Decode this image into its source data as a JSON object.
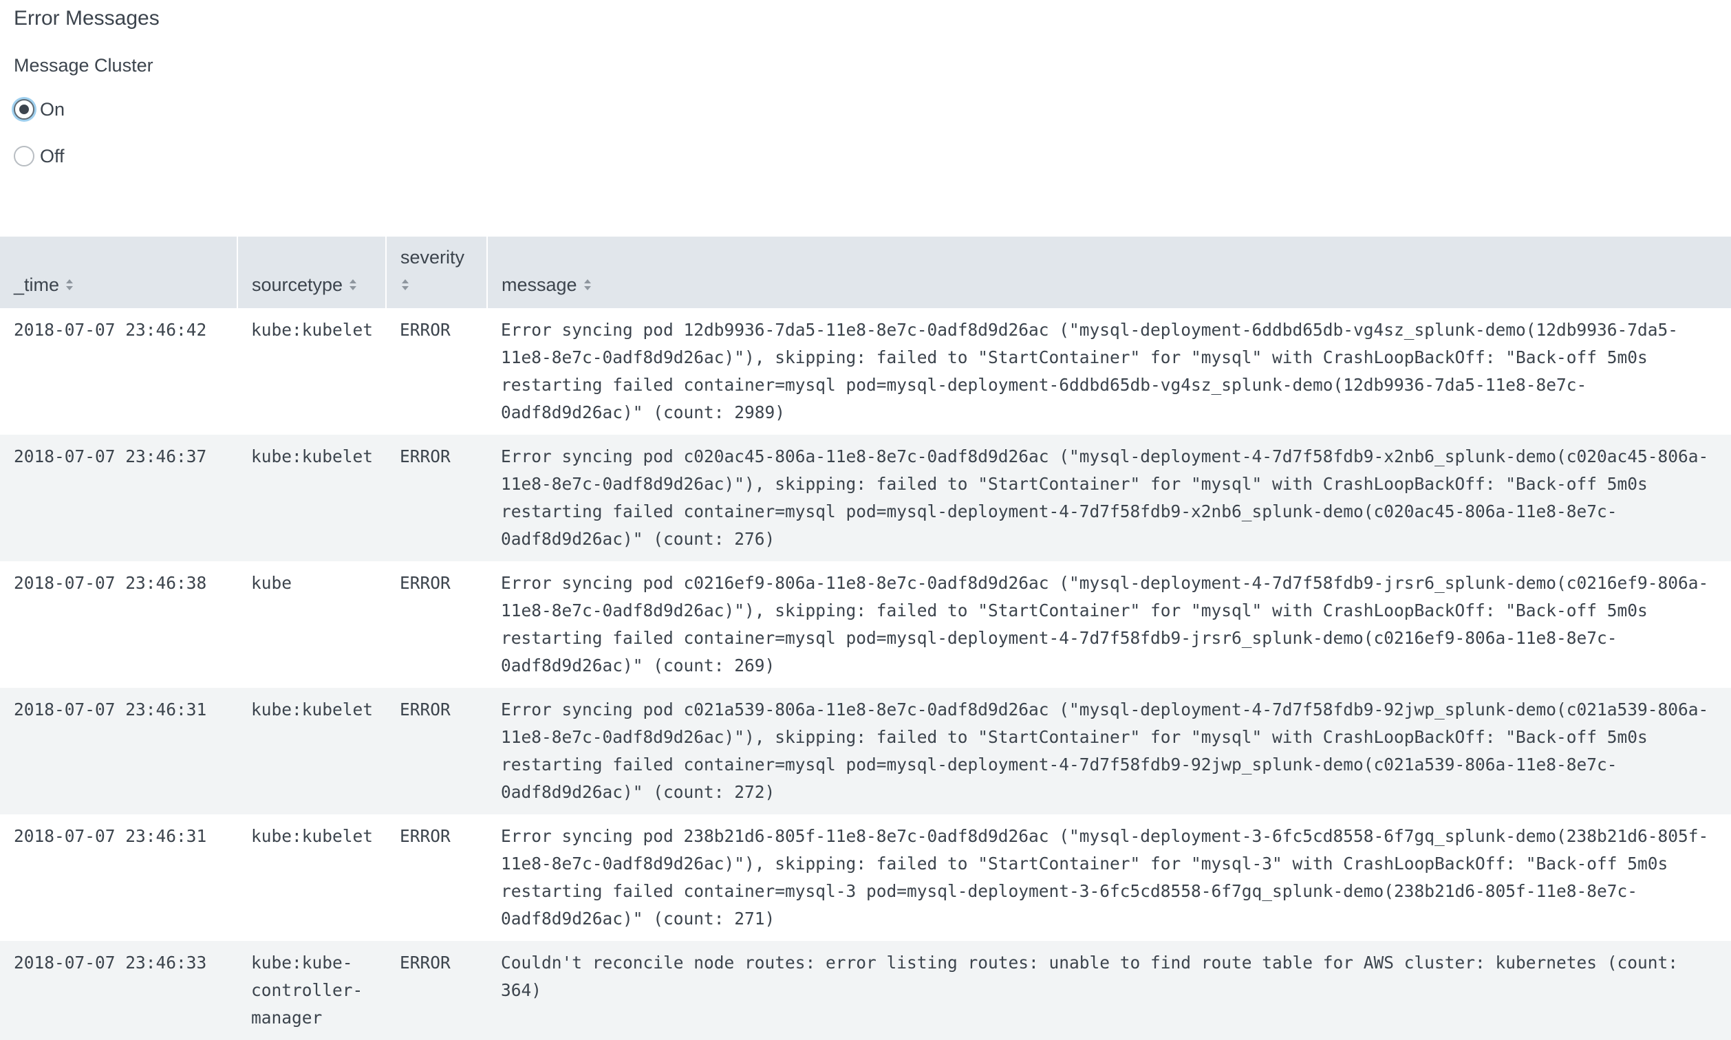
{
  "panel": {
    "title": "Error Messages"
  },
  "input": {
    "label": "Message Cluster",
    "options": [
      {
        "label": "On",
        "checked": true
      },
      {
        "label": "Off",
        "checked": false
      }
    ]
  },
  "table": {
    "columns": [
      "_time",
      "sourcetype",
      "severity",
      "message"
    ],
    "rows": [
      {
        "time": "2018-07-07 23:46:42",
        "sourcetype": "kube:kubelet",
        "severity": "ERROR",
        "message": "Error syncing pod 12db9936-7da5-11e8-8e7c-0adf8d9d26ac (\"mysql-deployment-6ddbd65db-vg4sz_splunk-demo(12db9936-7da5-11e8-8e7c-0adf8d9d26ac)\"), skipping: failed to \"StartContainer\" for \"mysql\" with CrashLoopBackOff: \"Back-off 5m0s restarting failed container=mysql pod=mysql-deployment-6ddbd65db-vg4sz_splunk-demo(12db9936-7da5-11e8-8e7c-0adf8d9d26ac)\" (count: 2989)"
      },
      {
        "time": "2018-07-07 23:46:37",
        "sourcetype": "kube:kubelet",
        "severity": "ERROR",
        "message": "Error syncing pod c020ac45-806a-11e8-8e7c-0adf8d9d26ac (\"mysql-deployment-4-7d7f58fdb9-x2nb6_splunk-demo(c020ac45-806a-11e8-8e7c-0adf8d9d26ac)\"), skipping: failed to \"StartContainer\" for \"mysql\" with CrashLoopBackOff: \"Back-off 5m0s restarting failed container=mysql pod=mysql-deployment-4-7d7f58fdb9-x2nb6_splunk-demo(c020ac45-806a-11e8-8e7c-0adf8d9d26ac)\" (count: 276)"
      },
      {
        "time": "2018-07-07 23:46:38",
        "sourcetype": "kube",
        "severity": "ERROR",
        "message": "Error syncing pod c0216ef9-806a-11e8-8e7c-0adf8d9d26ac (\"mysql-deployment-4-7d7f58fdb9-jrsr6_splunk-demo(c0216ef9-806a-11e8-8e7c-0adf8d9d26ac)\"), skipping: failed to \"StartContainer\" for \"mysql\" with CrashLoopBackOff: \"Back-off 5m0s restarting failed container=mysql pod=mysql-deployment-4-7d7f58fdb9-jrsr6_splunk-demo(c0216ef9-806a-11e8-8e7c-0adf8d9d26ac)\" (count: 269)"
      },
      {
        "time": "2018-07-07 23:46:31",
        "sourcetype": "kube:kubelet",
        "severity": "ERROR",
        "message": "Error syncing pod c021a539-806a-11e8-8e7c-0adf8d9d26ac (\"mysql-deployment-4-7d7f58fdb9-92jwp_splunk-demo(c021a539-806a-11e8-8e7c-0adf8d9d26ac)\"), skipping: failed to \"StartContainer\" for \"mysql\" with CrashLoopBackOff: \"Back-off 5m0s restarting failed container=mysql pod=mysql-deployment-4-7d7f58fdb9-92jwp_splunk-demo(c021a539-806a-11e8-8e7c-0adf8d9d26ac)\" (count: 272)"
      },
      {
        "time": "2018-07-07 23:46:31",
        "sourcetype": "kube:kubelet",
        "severity": "ERROR",
        "message": "Error syncing pod 238b21d6-805f-11e8-8e7c-0adf8d9d26ac (\"mysql-deployment-3-6fc5cd8558-6f7gq_splunk-demo(238b21d6-805f-11e8-8e7c-0adf8d9d26ac)\"), skipping: failed to \"StartContainer\" for \"mysql-3\" with CrashLoopBackOff: \"Back-off 5m0s restarting failed container=mysql-3 pod=mysql-deployment-3-6fc5cd8558-6f7gq_splunk-demo(238b21d6-805f-11e8-8e7c-0adf8d9d26ac)\" (count: 271)"
      },
      {
        "time": "2018-07-07 23:46:33",
        "sourcetype": "kube:kube-controller-manager",
        "severity": "ERROR",
        "message": "Couldn't reconcile node routes: error listing routes: unable to find route table for AWS cluster: kubernetes (count: 364)"
      }
    ]
  }
}
